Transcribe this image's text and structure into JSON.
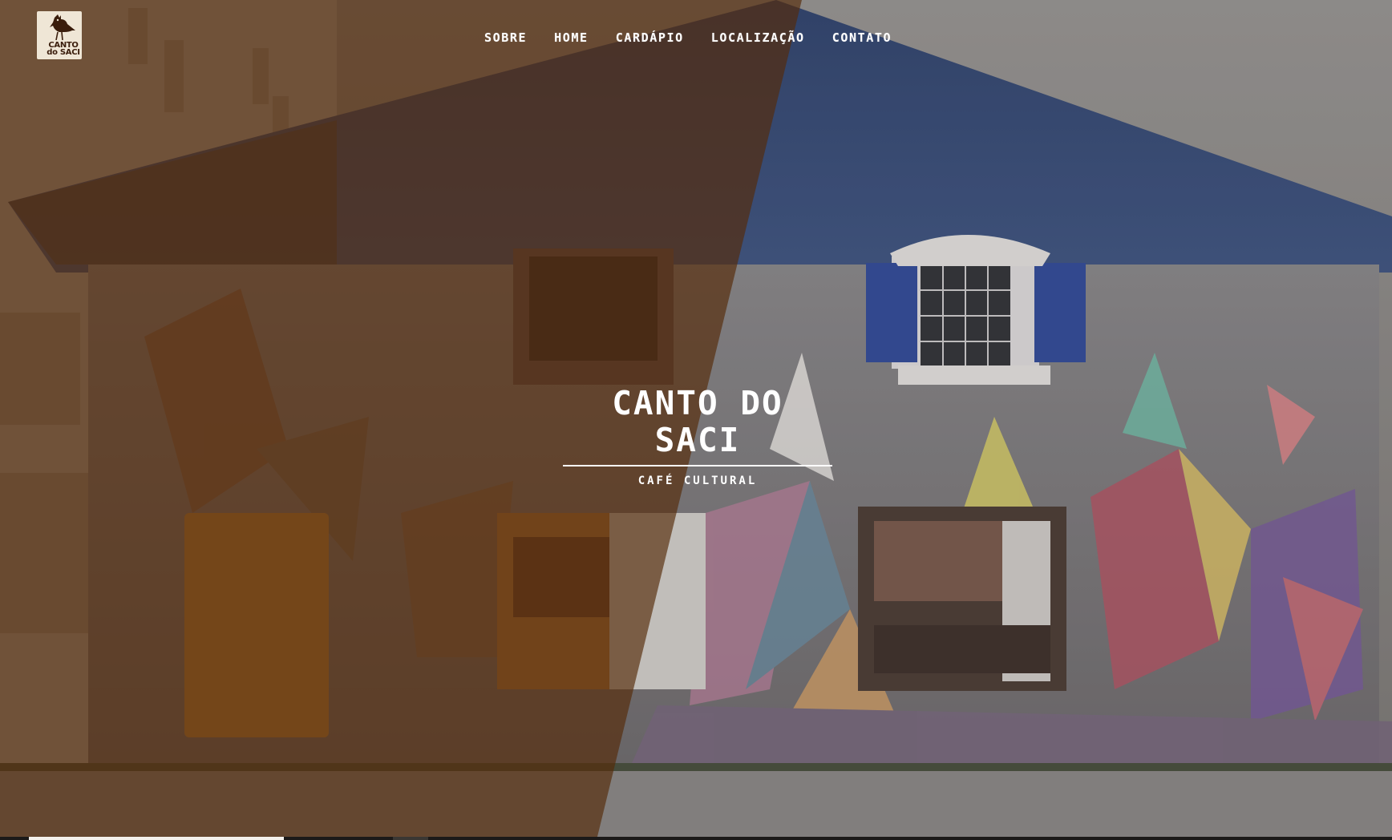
{
  "brand": {
    "logo_lines": [
      "CANTO",
      "do SACI"
    ],
    "title": "CANTO DO SACI",
    "tagline": "CAFÉ CULTURAL"
  },
  "nav": {
    "items": [
      {
        "label": "SOBRE"
      },
      {
        "label": "HOME"
      },
      {
        "label": "CARDÁPIO"
      },
      {
        "label": "LOCALIZAÇÃO"
      },
      {
        "label": "CONTATO"
      }
    ]
  },
  "colors": {
    "overlay_brown": "#542c0c",
    "text": "#ffffff",
    "logo_bg": "#efe6d6"
  }
}
